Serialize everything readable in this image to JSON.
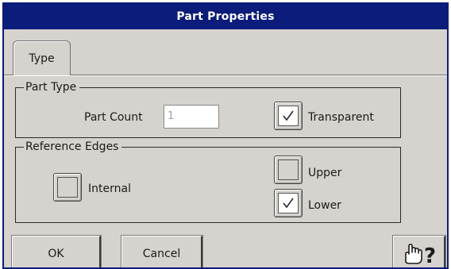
{
  "window": {
    "title": "Part Properties",
    "title_bg": "#0b1c7a",
    "body_bg": "#d6d3ce"
  },
  "tabs": [
    {
      "label": "Type",
      "selected": true
    }
  ],
  "part_type": {
    "legend": "Part Type",
    "part_count_label": "Part Count",
    "part_count_value": "1",
    "transparent_label": "Transparent",
    "transparent_checked": true
  },
  "reference_edges": {
    "legend": "Reference Edges",
    "internal_label": "Internal",
    "internal_checked": false,
    "upper_label": "Upper",
    "upper_checked": false,
    "lower_label": "Lower",
    "lower_checked": true
  },
  "buttons": {
    "ok_label": "OK",
    "cancel_label": "Cancel",
    "help_icon": "hand-question-icon"
  }
}
